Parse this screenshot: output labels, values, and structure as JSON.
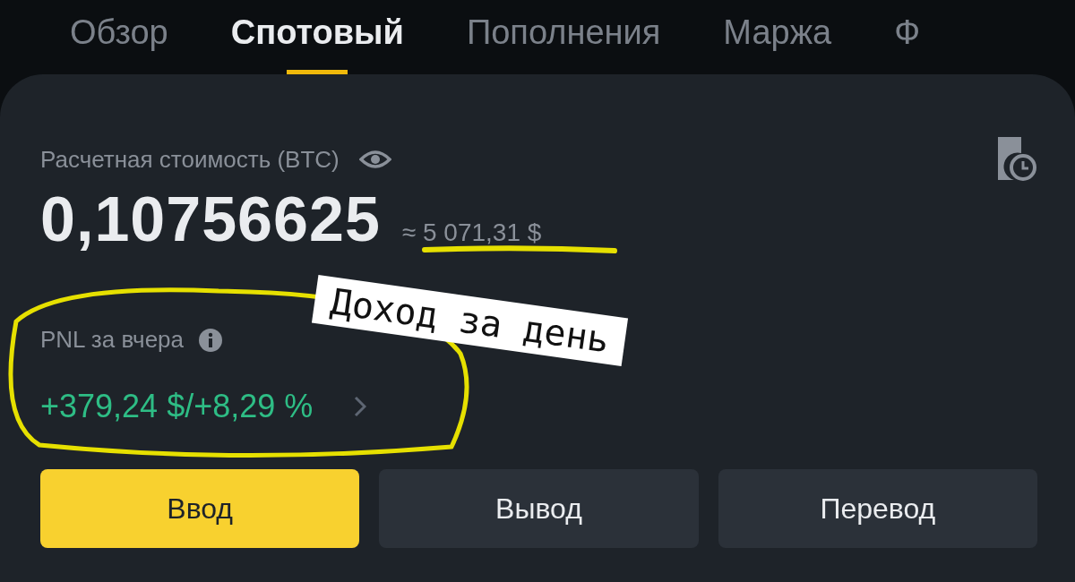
{
  "tabs": [
    {
      "label": "Обзор",
      "selected": false
    },
    {
      "label": "Спотовый",
      "selected": true
    },
    {
      "label": "Пополнения",
      "selected": false
    },
    {
      "label": "Маржа",
      "selected": false
    },
    {
      "label": "Ф",
      "selected": false
    }
  ],
  "balance": {
    "label": "Расчетная стоимость (BTC)",
    "value": "0,10756625",
    "approx": "≈ 5 071,31 $"
  },
  "pnl": {
    "label": "PNL за вчера",
    "value": "+379,24 $/+8,29 %"
  },
  "buttons": [
    {
      "label": "Ввод",
      "kind": "primary"
    },
    {
      "label": "Вывод",
      "kind": "secondary"
    },
    {
      "label": "Перевод",
      "kind": "secondary"
    }
  ],
  "annotation": {
    "text": "Доход за день"
  }
}
